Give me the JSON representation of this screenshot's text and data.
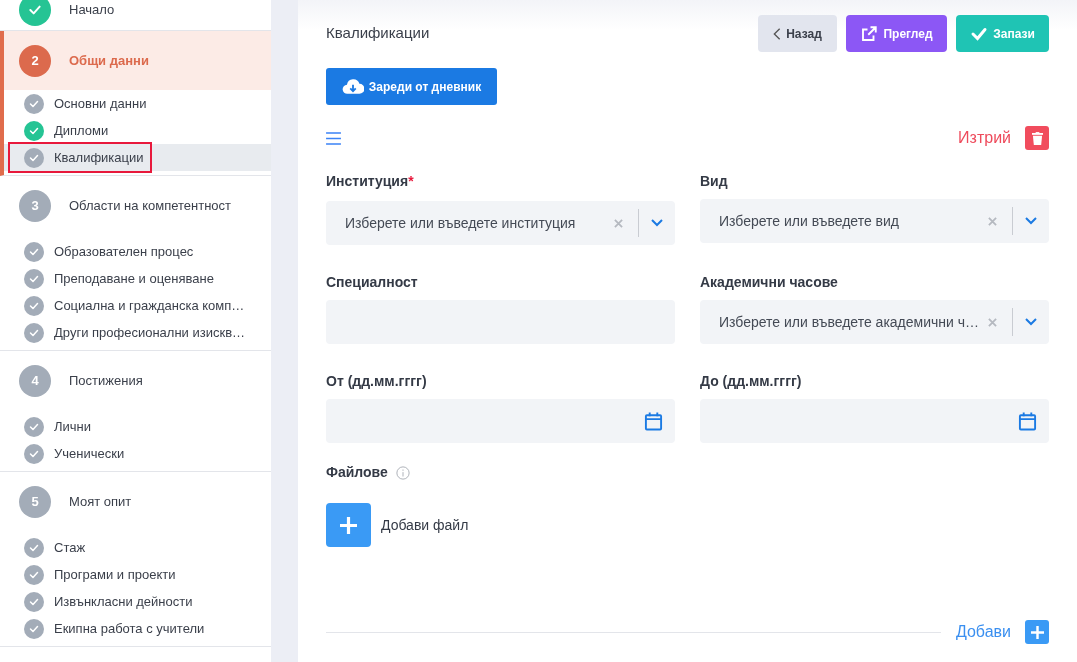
{
  "sidebar": {
    "steps": [
      {
        "label": "Начало",
        "kind": "done"
      },
      {
        "number": "2",
        "label": "Общи данни",
        "kind": "current",
        "children": [
          {
            "label": "Основни данни",
            "color": "#a3acb8",
            "selected": false
          },
          {
            "label": "Дипломи",
            "color": "#25c494",
            "selected": false
          },
          {
            "label": "Квалификации",
            "color": "#a3acb8",
            "selected": true
          }
        ]
      },
      {
        "number": "3",
        "label": "Области на компетентност",
        "kind": "pending",
        "children": [
          {
            "label": "Образователен процес",
            "color": "#a3acb8",
            "selected": false
          },
          {
            "label": "Преподаване и оценяване",
            "color": "#a3acb8",
            "selected": false
          },
          {
            "label": "Социална и гражданска комп…",
            "color": "#a3acb8",
            "selected": false
          },
          {
            "label": "Други професионални изискв…",
            "color": "#a3acb8",
            "selected": false
          }
        ]
      },
      {
        "number": "4",
        "label": "Постижения",
        "kind": "pending",
        "children": [
          {
            "label": "Лични",
            "color": "#a3acb8",
            "selected": false
          },
          {
            "label": "Ученически",
            "color": "#a3acb8",
            "selected": false
          }
        ]
      },
      {
        "number": "5",
        "label": "Моят опит",
        "kind": "pending",
        "children": [
          {
            "label": "Стаж",
            "color": "#a3acb8",
            "selected": false
          },
          {
            "label": "Програми и проекти",
            "color": "#a3acb8",
            "selected": false
          },
          {
            "label": "Извънкласни дейности",
            "color": "#a3acb8",
            "selected": false
          },
          {
            "label": "Екипна работа с учители",
            "color": "#a3acb8",
            "selected": false
          }
        ]
      }
    ]
  },
  "header": {
    "title": "Квалификации",
    "buttons": [
      {
        "kind": "back",
        "label": "Назад"
      },
      {
        "kind": "preview",
        "label": "Преглед"
      },
      {
        "kind": "save",
        "label": "Запази"
      }
    ]
  },
  "load_button": "Зареди от дневник",
  "delete_label": "Изтрий",
  "form": {
    "fields": [
      {
        "label": "Институция",
        "required_mark": "*",
        "kind": "select",
        "placeholder": "Изберете или въведете институция"
      },
      {
        "label": "Вид",
        "kind": "select",
        "placeholder": "Изберете или въведете вид"
      },
      {
        "label": "Специалност",
        "kind": "text"
      },
      {
        "label": "Академични часове",
        "kind": "select",
        "placeholder": "Изберете или въведете академични ч…"
      },
      {
        "label": "От (дд.мм.гггг)",
        "kind": "date"
      },
      {
        "label": "До (дд.мм.гггг)",
        "kind": "date"
      }
    ]
  },
  "files": {
    "label": "Файлове",
    "add_file": "Добави файл"
  },
  "add_label": "Добави"
}
